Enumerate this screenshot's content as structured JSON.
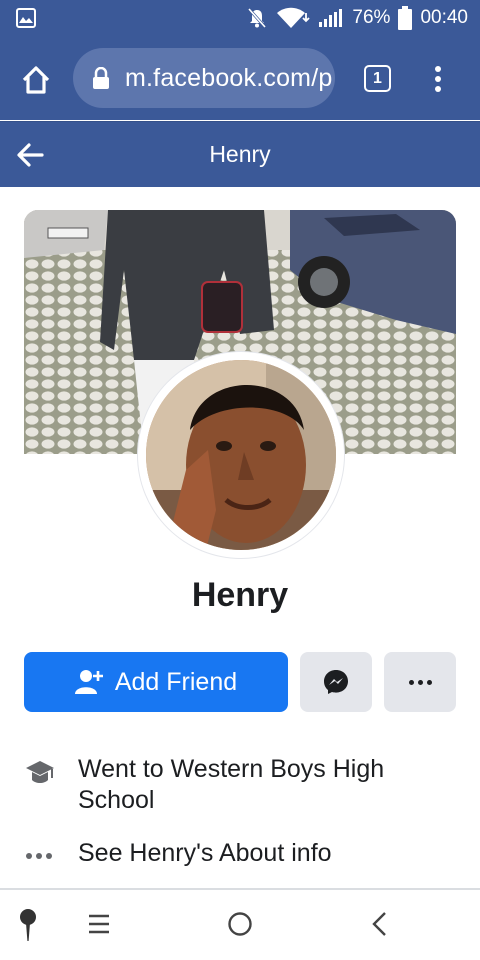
{
  "status_bar": {
    "battery_percent": "76%",
    "time": "00:40",
    "icons": [
      "gallery-icon",
      "mute-icon",
      "wifi-icon",
      "signal-icon",
      "battery-icon"
    ]
  },
  "browser": {
    "url": "m.facebook.com/p",
    "tab_count": "1",
    "icons": [
      "home-icon",
      "lock-icon",
      "overflow-menu-icon"
    ]
  },
  "header": {
    "title": "Henry",
    "back_icon": "back-arrow-icon"
  },
  "profile": {
    "name": "Henry",
    "add_friend_label": "Add Friend",
    "icons": [
      "add-friend-icon",
      "messenger-icon",
      "more-icon"
    ]
  },
  "info": {
    "education": "Went to Western Boys High School",
    "about": "See Henry's About info",
    "icons": [
      "graduation-cap-icon",
      "ellipsis-icon"
    ]
  },
  "nav_bar": {
    "icons": [
      "pin-icon",
      "recents-icon",
      "home-circle-icon",
      "back-chevron-icon"
    ]
  },
  "colors": {
    "facebook_header": "#3b5998",
    "url_pill": "#5d76ad",
    "add_friend_button": "#1877f2",
    "secondary_button": "#e4e6eb"
  }
}
